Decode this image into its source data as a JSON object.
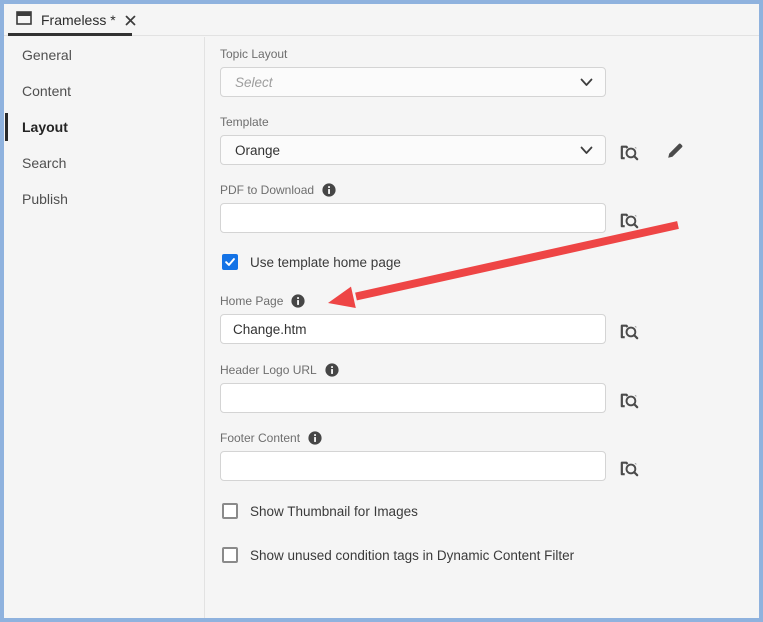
{
  "colors": {
    "window_border": "#8fb2de",
    "background": "#f5f5f5",
    "accent_blue": "#1473e6",
    "annotation_arrow_red": "#ee4545",
    "active_tab_underline": "#323232",
    "icon_gray": "#4b4b4b"
  },
  "tab": {
    "title": "Frameless *",
    "icons": [
      "window-icon",
      "close-icon"
    ]
  },
  "sidebar": {
    "items": [
      {
        "label": "General",
        "active": false
      },
      {
        "label": "Content",
        "active": false
      },
      {
        "label": "Layout",
        "active": true
      },
      {
        "label": "Search",
        "active": false
      },
      {
        "label": "Publish",
        "active": false
      }
    ]
  },
  "form": {
    "topic_layout": {
      "label": "Topic Layout",
      "placeholder": "Select",
      "value": ""
    },
    "template": {
      "label": "Template",
      "value": "Orange",
      "icons": [
        "browse-location-icon",
        "edit-pencil-icon"
      ]
    },
    "pdf_to_download": {
      "label": "PDF to Download",
      "value": "",
      "has_info_icon": true,
      "icons": [
        "browse-location-icon"
      ]
    },
    "use_template_home_page": {
      "label": "Use template home page",
      "checked": true
    },
    "home_page": {
      "label": "Home Page",
      "value": "Change.htm",
      "has_info_icon": true,
      "icons": [
        "browse-location-icon"
      ]
    },
    "header_logo_url": {
      "label": "Header Logo URL",
      "value": "",
      "has_info_icon": true,
      "icons": [
        "browse-location-icon"
      ]
    },
    "footer_content": {
      "label": "Footer Content",
      "value": "",
      "has_info_icon": true,
      "icons": [
        "browse-location-icon"
      ]
    },
    "show_thumbnail_for_images": {
      "label": "Show Thumbnail for Images",
      "checked": false
    },
    "show_unused_condition_tags": {
      "label": "Show unused condition tags in Dynamic Content Filter",
      "checked": false
    }
  },
  "annotation": {
    "type": "red-arrow",
    "points_at": "Home Page field"
  }
}
